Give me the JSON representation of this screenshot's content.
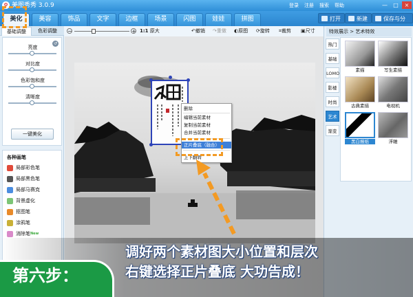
{
  "app": {
    "title": "美图秀秀 3.0.9",
    "links": [
      "登录",
      "注册",
      "搜索",
      "帮助"
    ]
  },
  "window_buttons": {
    "minimize": "—",
    "maximize": "□",
    "close": "×"
  },
  "tabs": [
    "美化",
    "美容",
    "饰品",
    "文字",
    "边框",
    "场景",
    "闪图",
    "娃娃",
    "拼图"
  ],
  "actions": {
    "open": "打开",
    "new": "新建",
    "save": "保存与分享"
  },
  "left_panel": {
    "tabs": [
      "基础调整",
      "色彩调整"
    ],
    "sliders": [
      {
        "label": "亮度",
        "level": 0.5
      },
      {
        "label": "对比度",
        "level": 0.5
      },
      {
        "label": "色彩饱和度",
        "level": 0.5
      },
      {
        "label": "清晰度",
        "level": 0.5
      }
    ],
    "one_key": "一键美化",
    "brushes_title": "各种画笔",
    "brushes": [
      {
        "label": "局部彩色笔",
        "color": "#e04a3a"
      },
      {
        "label": "局部黑色笔",
        "color": "#555555"
      },
      {
        "label": "局部马赛克",
        "color": "#4a8de0"
      },
      {
        "label": "背景虚化",
        "color": "#7cc576"
      },
      {
        "label": "抠图笔",
        "color": "#e88a2a"
      },
      {
        "label": "涂鸦笔",
        "color": "#c9b037"
      },
      {
        "label": "消除笔",
        "color": "#d98ac9",
        "badge": "New"
      }
    ]
  },
  "toolbar": {
    "zoom_minus": "−",
    "zoom_plus": "+",
    "zoom_ratio": "1:1",
    "original_size": "原大",
    "undo": "撤销",
    "redo": "重做",
    "original": "原图",
    "rotate": "旋转",
    "crop": "裁剪",
    "resize": "尺寸"
  },
  "context_menu": {
    "items": [
      "删除",
      "编辑当前素材",
      "复制当前素材",
      "合并当前素材",
      "正片叠底（融合）",
      "上下翻转"
    ],
    "highlighted_index": 4
  },
  "right_panel": {
    "header": "特效展示 > 艺术特效",
    "categories": [
      "热门",
      "基础",
      "LOMO",
      "影楼",
      "时尚",
      "艺术",
      "渐变"
    ],
    "active_category": 5,
    "effects": [
      "素描",
      "写生素描",
      "古典素描",
      "电视机",
      "黑白报纸",
      "浮雕"
    ],
    "selected_effect": 4
  },
  "banner": {
    "step": "第六步：",
    "line1": "调好两个素材图大小位置和层次",
    "line2": "右键选择正片叠底 大功告成！"
  },
  "colors": {
    "accent": "#2c86d1",
    "callout": "#f39a23",
    "step_badge": "#1b9a45"
  }
}
